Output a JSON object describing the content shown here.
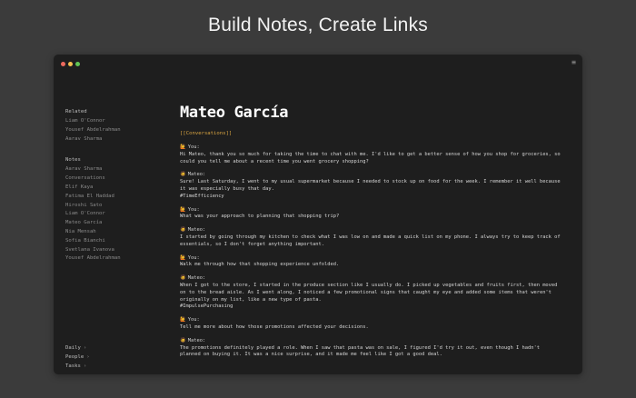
{
  "hero": {
    "title": "Build Notes, Create Links"
  },
  "window": {
    "menu_icon": "≡"
  },
  "sidebar": {
    "related": {
      "heading": "Related",
      "items": [
        "Liam O'Connor",
        "Yousef Abdelrahman",
        "Aarav Sharma"
      ]
    },
    "notes": {
      "heading": "Notes",
      "items": [
        "Aarav Sharma",
        "Conversations",
        "Elif Kaya",
        "Fatima El Haddad",
        "Hiroshi Sato",
        "Liam O'Connor",
        "Mateo García",
        "Nia Mensah",
        "Sofia Bianchi",
        "Svetlana Ivanova",
        "Yousef Abdelrahman"
      ]
    },
    "bottom": [
      {
        "label": "Daily",
        "chevron": "›"
      },
      {
        "label": "People",
        "chevron": "›"
      },
      {
        "label": "Tasks",
        "chevron": "›"
      }
    ]
  },
  "note": {
    "title": "Mateo García",
    "link": "[[Conversations]]",
    "messages": [
      {
        "emoji": "🙋",
        "speaker": "You:",
        "text": "Hi Mateo, thank you so much for taking the time to chat with me. I'd like to get a better sense of how you shop for groceries, so could you tell me about a recent time you went grocery shopping?",
        "tag": ""
      },
      {
        "emoji": "🧔",
        "speaker": "Mateo:",
        "text": "Sure! Last Saturday, I went to my usual supermarket because I needed to stock up on food for the week. I remember it well because it was especially busy that day.",
        "tag": "#TimeEfficiency"
      },
      {
        "emoji": "🙋",
        "speaker": "You:",
        "text": "What was your approach to planning that shopping trip?",
        "tag": ""
      },
      {
        "emoji": "🧔",
        "speaker": "Mateo:",
        "text": "I started by going through my kitchen to check what I was low on and made a quick list on my phone. I always try to keep track of essentials, so I don't forget anything important.",
        "tag": ""
      },
      {
        "emoji": "🙋",
        "speaker": "You:",
        "text": "Walk me through how that shopping experience unfolded.",
        "tag": ""
      },
      {
        "emoji": "🧔",
        "speaker": "Mateo:",
        "text": "When I got to the store, I started in the produce section like I usually do. I picked up vegetables and fruits first, then moved on to the bread aisle. As I went along, I noticed a few promotional signs that caught my eye and added some items that weren't originally on my list, like a new type of pasta.",
        "tag": "#ImpulsePurchasing"
      },
      {
        "emoji": "🙋",
        "speaker": "You:",
        "text": "Tell me more about how those promotions affected your decisions.",
        "tag": ""
      },
      {
        "emoji": "🧔",
        "speaker": "Mateo:",
        "text": "The promotions definitely played a role. When I saw that pasta was on sale, I figured I'd try it out, even though I hadn't planned on buying it. It was a nice surprise, and it made me feel like I got a good deal.",
        "tag": ""
      }
    ]
  }
}
